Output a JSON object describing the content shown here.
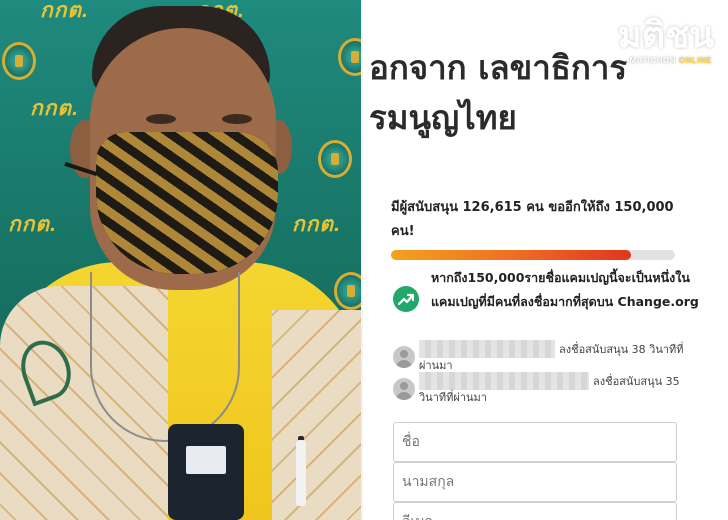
{
  "photo": {
    "backdrop_text": [
      "กกต.",
      "กกต.",
      "กกต.",
      "กกต.",
      "กกต."
    ]
  },
  "petition": {
    "headline_line1": "อกจาก เลขาธิการ",
    "headline_line2": "รมนูญไทย",
    "support_text": "มีผู้สนับสนุน 126,615 คน ขออีกให้ถึง 150,000 คน!",
    "signatures": 126615,
    "goal": 150000,
    "progress_fraction": 0.844,
    "progress_colors": [
      "#f3a21e",
      "#ee6a22",
      "#e0351f"
    ],
    "milestone_icon": "trending-up-icon",
    "milestone_icon_color": "#22a86b",
    "milestone_text": "หากถึง150,000รายชื่อแคมเปญนี้จะเป็นหนึ่งในแคมเปญที่มีคนที่ลงชื่อมากที่สุดบน Change.org",
    "signers": [
      {
        "text": "ลงชื่อสนับสนุน 38 วินาทีที่",
        "text2": "ผ่านมา"
      },
      {
        "text": "ลงชื่อสนับสนุน 35",
        "text2": "วินาทีที่ผ่านมา"
      }
    ],
    "form": {
      "first_name_placeholder": "ชื่อ",
      "last_name_placeholder": "นามสกุล",
      "email_placeholder": "อีเมล"
    }
  },
  "watermark": {
    "main": "มติชน",
    "sub_prefix": "MATICHON",
    "sub_accent": " ONLINE"
  }
}
